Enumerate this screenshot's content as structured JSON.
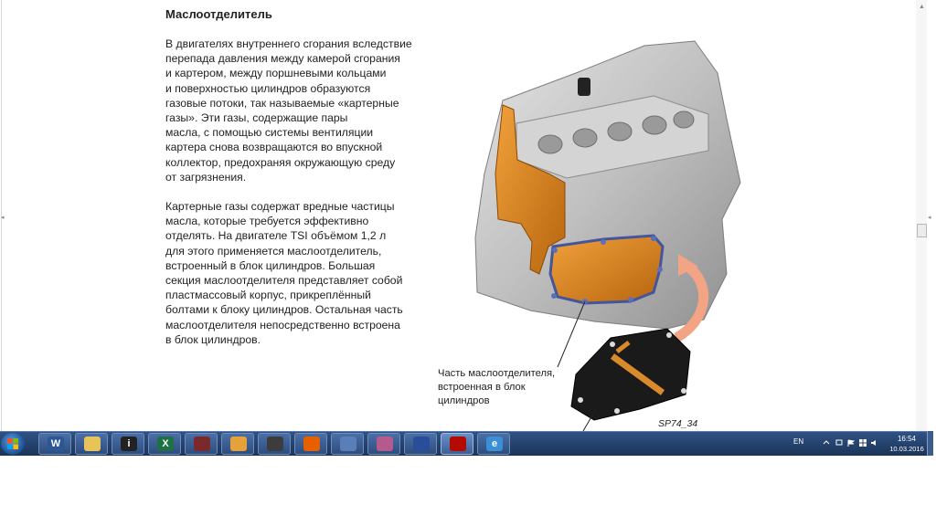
{
  "document": {
    "title": "Маслоотделитель",
    "paragraphs": [
      "В двигателях внутреннего сгорания вследствие\nперепада давления между камерой сгорания\nи картером, между поршневыми кольцами\nи поверхностью цилиндров образуются\nгазовые потоки, так называемые «картерные\nгазы». Эти газы, содержащие пары\nмасла, с помощью системы вентиляции\nкартера снова возвращаются во впускной\nколлектор, предохраняя окружающую среду\nот загрязнения.",
      "Картерные газы содержат вредные частицы\nмасла, которые требуется эффективно\nотделять. На двигателе TSI объёмом 1,2 л\nдля этого применяется маслоотделитель,\nвстроенный в блок цилиндров. Большая\nсекция маслоотделителя представляет собой\nпластмассовый корпус, прикреплённый\nболтами к блоку цилиндров. Остальная часть\nмаслоотделителя непосредственно встроена\nв блок цилиндров."
    ],
    "figure_caption": "Часть маслоотделителя,\nвстроенная в блок\nцилиндров",
    "figure_id": "SP74_34"
  },
  "taskbar": {
    "apps": [
      {
        "icon": "word-icon",
        "glyph": "W",
        "color": "#2b5797",
        "active": false
      },
      {
        "icon": "file-explorer-icon",
        "glyph": "",
        "color": "#e8c35a",
        "active": false
      },
      {
        "icon": "info-app-icon",
        "glyph": "i",
        "color": "#222222",
        "active": false
      },
      {
        "icon": "excel-icon",
        "glyph": "X",
        "color": "#1e7145",
        "active": false
      },
      {
        "icon": "media-player-icon",
        "glyph": "",
        "color": "#7a2a2a",
        "active": false
      },
      {
        "icon": "mail-icon",
        "glyph": "",
        "color": "#e6a23a",
        "active": false
      },
      {
        "icon": "network-tool-icon",
        "glyph": "",
        "color": "#3c3c3c",
        "active": false
      },
      {
        "icon": "firefox-icon",
        "glyph": "",
        "color": "#e66000",
        "active": false
      },
      {
        "icon": "volume-app-icon",
        "glyph": "",
        "color": "#5a7fb8",
        "active": false
      },
      {
        "icon": "paint-icon",
        "glyph": "",
        "color": "#b45a8c",
        "active": false
      },
      {
        "icon": "user-tool-icon",
        "glyph": "",
        "color": "#2a4d9a",
        "active": false
      },
      {
        "icon": "pdf-reader-icon",
        "glyph": "",
        "color": "#b30b00",
        "active": true
      },
      {
        "icon": "internet-explorer-icon",
        "glyph": "e",
        "color": "#3a8fd6",
        "active": false
      }
    ],
    "tray": {
      "language": "EN",
      "time": "16:54",
      "date": "10.03.2016"
    }
  }
}
